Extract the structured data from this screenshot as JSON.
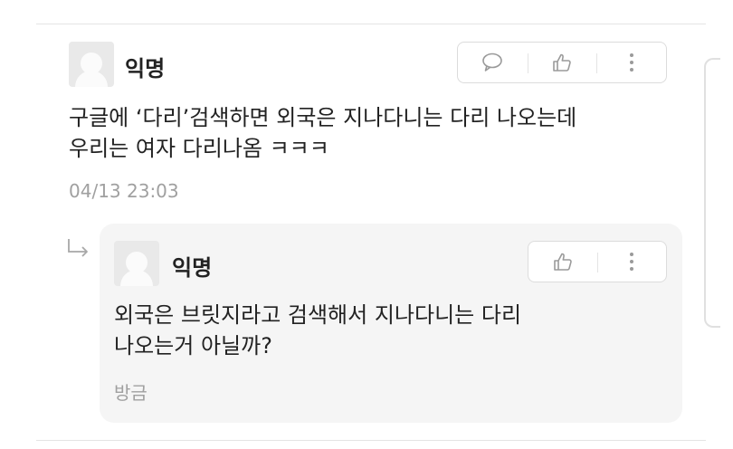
{
  "comment": {
    "author": "익명",
    "text_lines": [
      "구글에 ‘다리’검색하면 외국은 지나다니는 다리 나오는데",
      "우리는 여자 다리나옴 ㅋㅋㅋ"
    ],
    "timestamp": "04/13 23:03",
    "actions": [
      "comment-icon",
      "thumbs-up-icon",
      "more-vertical-icon"
    ]
  },
  "reply": {
    "author": "익명",
    "text_lines": [
      "외국은 브릿지라고 검색해서 지나다니는 다리",
      "나오는거 아닐까?"
    ],
    "timestamp": "방금",
    "actions": [
      "thumbs-up-icon",
      "more-vertical-icon"
    ]
  },
  "colors": {
    "text": "#222222",
    "muted": "#a0a0a0",
    "icon": "#9a9a9a",
    "reply_bg": "#f5f5f5",
    "border": "#dcdcdc"
  }
}
